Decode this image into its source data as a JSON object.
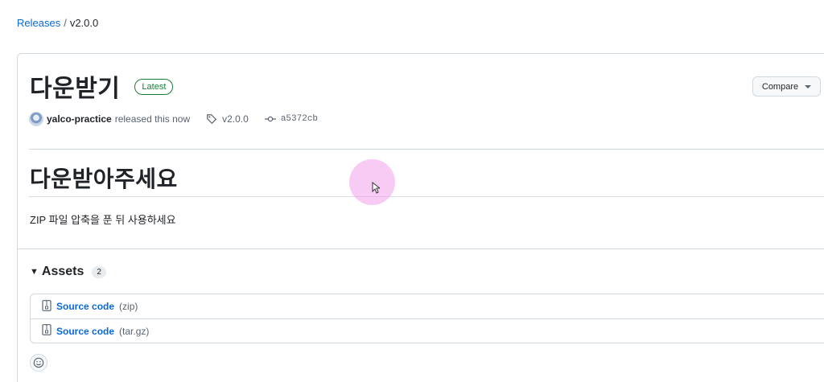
{
  "breadcrumb": {
    "parent": "Releases",
    "separator": "/",
    "current": "v2.0.0"
  },
  "release": {
    "title": "다운받기",
    "badge": "Latest",
    "compare_label": "Compare",
    "author": "yalco-practice",
    "released_text": "released this now",
    "tag": "v2.0.0",
    "commit": "a5372cb"
  },
  "body": {
    "heading": "다운받아주세요",
    "text": "ZIP 파일 압축을 푼 뒤 사용하세요"
  },
  "assets": {
    "label": "Assets",
    "count": "2",
    "items": [
      {
        "name": "Source code",
        "ext": "(zip)"
      },
      {
        "name": "Source code",
        "ext": "(tar.gz)"
      }
    ]
  },
  "colors": {
    "link": "#0969da",
    "latest": "#1a7f37",
    "cursor_highlight": "#f0a0eb"
  },
  "icons": [
    "tag-icon",
    "commit-icon",
    "file-zip-icon",
    "smiley-icon",
    "triangle-down-icon",
    "cursor-icon"
  ]
}
